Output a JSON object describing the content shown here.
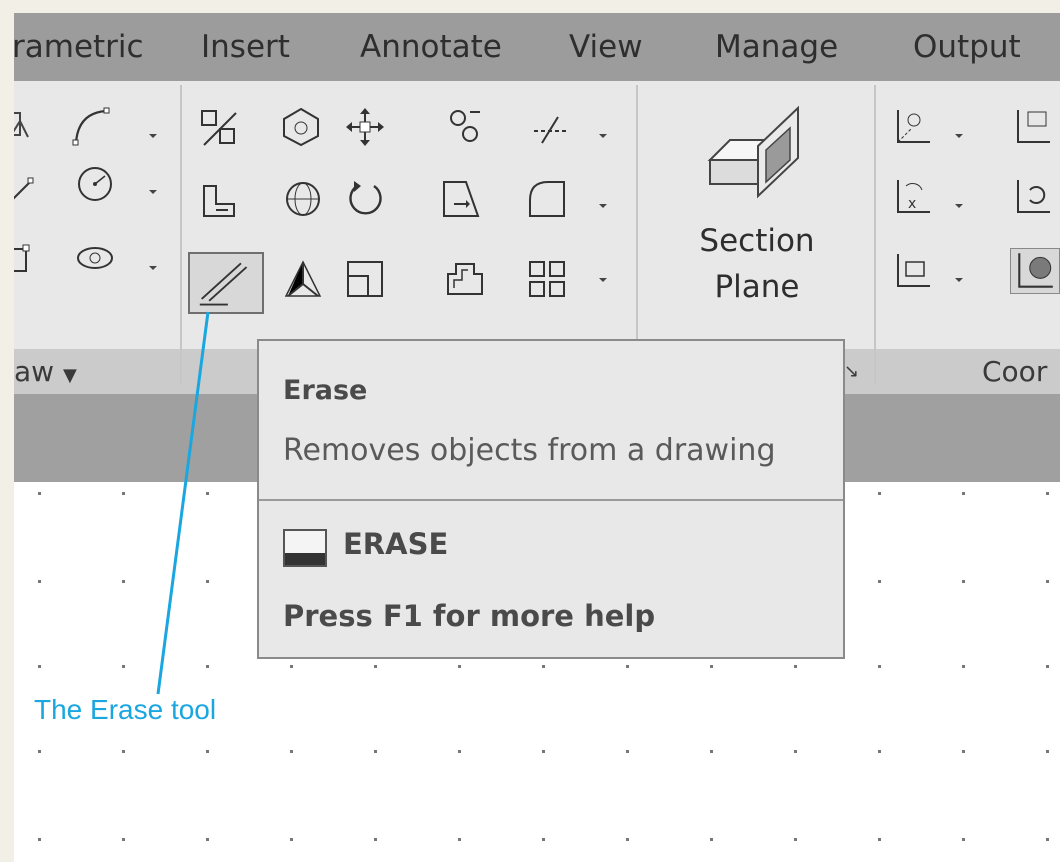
{
  "ribbon": {
    "tabs": [
      {
        "label": "rametric"
      },
      {
        "label": "Insert"
      },
      {
        "label": "Annotate"
      },
      {
        "label": "View"
      },
      {
        "label": "Manage"
      },
      {
        "label": "Output"
      }
    ],
    "panels": {
      "draw_title": "aw",
      "coordinates_title": "Coor"
    },
    "section_plane": {
      "line1": "Section",
      "line2": "Plane"
    }
  },
  "tooltip": {
    "title": "Erase",
    "description": "Removes objects from a drawing",
    "command": "ERASE",
    "help": "Press F1 for more help"
  },
  "callout": {
    "label": "The Erase tool",
    "color": "#1aa6df"
  },
  "colors": {
    "tab_bar": "#9c9c9c",
    "ribbon_body": "#e8e8e8",
    "panel_title_bar": "#cbcbcb",
    "tooltip_bg": "#e8e8e8"
  }
}
